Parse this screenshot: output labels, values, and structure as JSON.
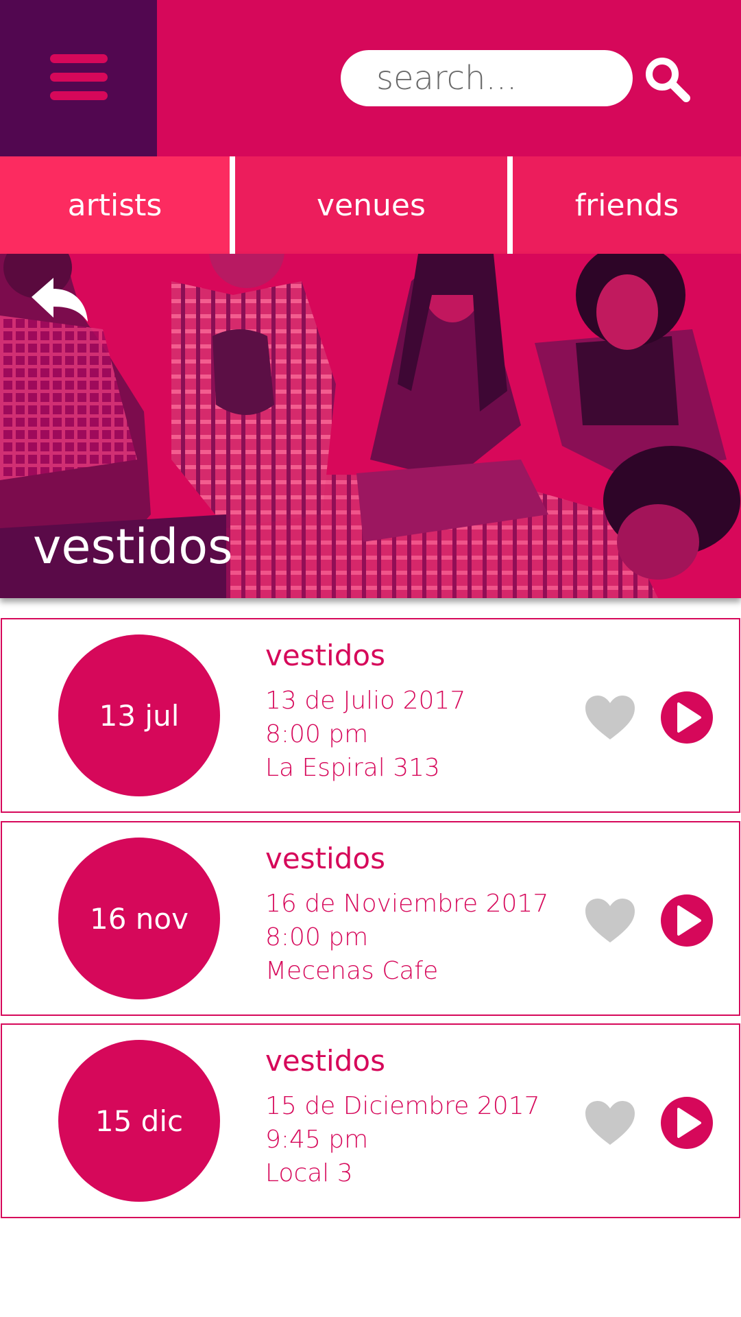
{
  "search": {
    "placeholder": "search..."
  },
  "tabs": [
    {
      "label": "artists"
    },
    {
      "label": "venues"
    },
    {
      "label": "friends"
    }
  ],
  "hero": {
    "title": "vestidos"
  },
  "events": [
    {
      "badge": "13 jul",
      "title": "vestidos",
      "date": "13 de Julio 2017",
      "time": "8:00 pm",
      "venue": "La Espiral 313"
    },
    {
      "badge": "16 nov",
      "title": "vestidos",
      "date": "16 de Noviembre 2017",
      "time": "8:00 pm",
      "venue": "Mecenas Cafe"
    },
    {
      "badge": "15 dic",
      "title": "vestidos",
      "date": "15 de Diciembre 2017",
      "time": "9:45 pm",
      "venue": "Local 3"
    }
  ],
  "icons": {
    "menu": "hamburger-menu-icon",
    "search": "search-icon",
    "back": "back-arrow-icon",
    "like": "heart-icon",
    "play": "play-icon"
  },
  "colors": {
    "primary": "#d6085a",
    "menu_background": "#520750",
    "tab_active": "#fc2b60",
    "tab": "#ec1d5c",
    "heart_inactive": "#c8c8c8"
  }
}
